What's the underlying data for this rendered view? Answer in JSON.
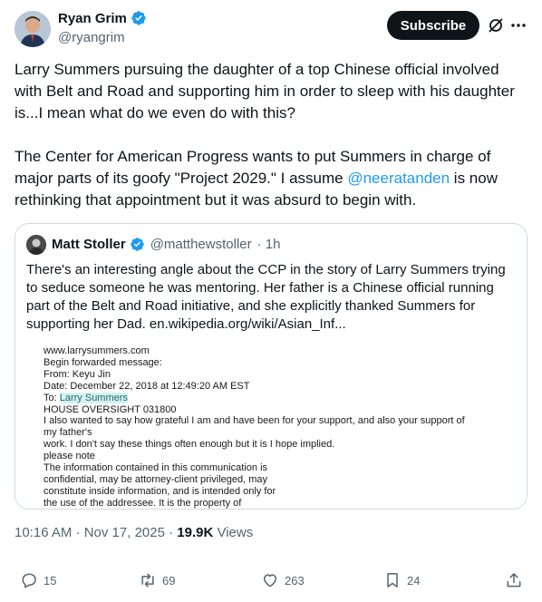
{
  "author": {
    "display_name": "Ryan Grim",
    "handle": "@ryangrim"
  },
  "header": {
    "subscribe_label": "Subscribe"
  },
  "tweet": {
    "paragraph1": "Larry Summers pursuing the daughter of a top Chinese official involved with Belt and Road and supporting him in order to sleep with his daughter is...I mean what do we even do with this?",
    "paragraph2_before": "The Center for American Progress wants to put Summers in charge of major parts of its goofy \"Project 2029.\" I assume ",
    "mention": "@neeratanden",
    "paragraph2_after": " is now rethinking that appointment but it was absurd to begin with."
  },
  "quote": {
    "display_name": "Matt Stoller",
    "handle": "@matthewstoller",
    "time": "· 1h",
    "text": "There's an interesting angle about the CCP in the story of Larry Summers trying to seduce someone he was mentoring. Her father is a Chinese official running part of the Belt and Road initiative, and she explicitly thanked Summers for supporting her Dad. en.wikipedia.org/wiki/Asian_Inf...",
    "document": {
      "line1": "www.larrysummers.com",
      "line2": "Begin forwarded message:",
      "line3": "From: Keyu Jin",
      "line4": "Date: December 22, 2018 at 12:49:20 AM EST",
      "line5_prefix": "To: ",
      "line5_highlight": "Larry Summers",
      "line6": "HOUSE OVERSIGHT 031800",
      "line7": "I also wanted to say how grateful I am and have been for your support, and also your support of",
      "line8": "my father's",
      "line9": "work. I don't say these things often enough but it is I hope implied.",
      "line10": "please note",
      "line11": "The information contained in this communication is",
      "line12": "confidential, may be attorney-client privileged, may",
      "line13": "constitute inside information, and is intended only for",
      "line14": "the use of the addressee. It is the property of"
    }
  },
  "meta": {
    "timestamp": "10:16 AM · Nov 17, 2025 · ",
    "views_count": "19.9K",
    "views_label": " Views"
  },
  "actions": {
    "replies": "15",
    "reposts": "69",
    "likes": "263",
    "bookmarks": "24"
  },
  "colors": {
    "accent": "#1d9bf0",
    "text": "#0f1419",
    "secondary": "#536471",
    "border": "#cfd9de"
  }
}
